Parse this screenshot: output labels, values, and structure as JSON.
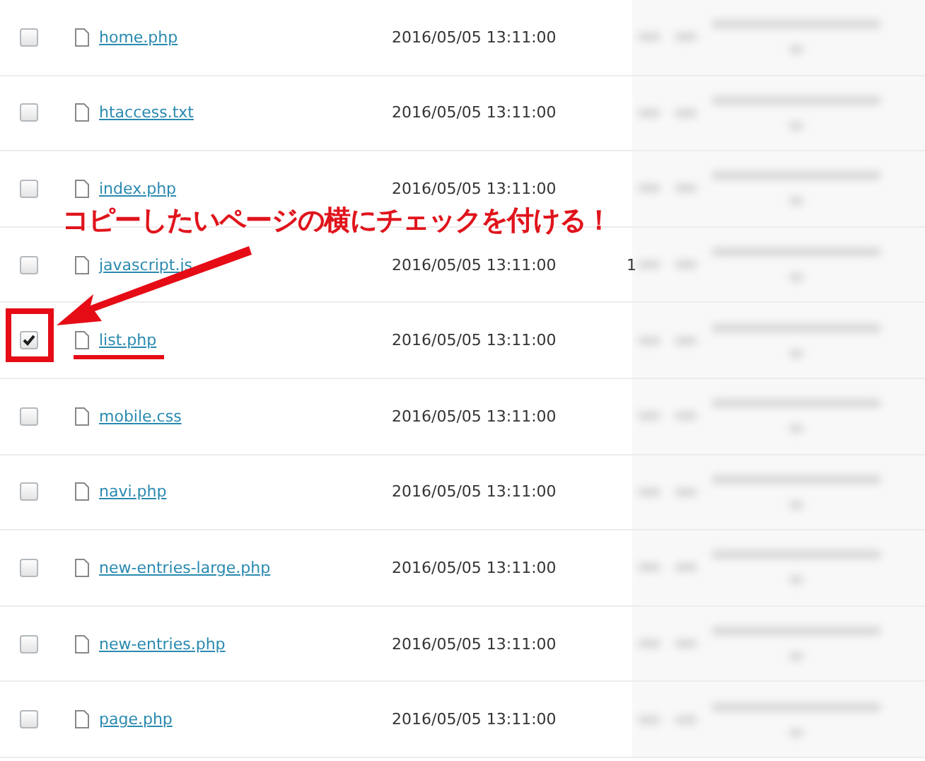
{
  "files": [
    {
      "name": "home.php",
      "modified": "2016/05/05 13:11:00",
      "checked": false
    },
    {
      "name": "htaccess.txt",
      "modified": "2016/05/05 13:11:00",
      "checked": false
    },
    {
      "name": "index.php",
      "modified": "2016/05/05 13:11:00",
      "checked": false
    },
    {
      "name": "javascript.js",
      "modified": "2016/05/05 13:11:00",
      "checked": false,
      "column_3": "1"
    },
    {
      "name": "list.php",
      "modified": "2016/05/05 13:11:00",
      "checked": true
    },
    {
      "name": "mobile.css",
      "modified": "2016/05/05 13:11:00",
      "checked": false
    },
    {
      "name": "navi.php",
      "modified": "2016/05/05 13:11:00",
      "checked": false
    },
    {
      "name": "new-entries-large.php",
      "modified": "2016/05/05 13:11:00",
      "checked": false
    },
    {
      "name": "new-entries.php",
      "modified": "2016/05/05 13:11:00",
      "checked": false
    },
    {
      "name": "page.php",
      "modified": "2016/05/05 13:11:00",
      "checked": false
    }
  ],
  "annotation": {
    "text": "コピーしたいページの横にチェックを付ける！"
  }
}
